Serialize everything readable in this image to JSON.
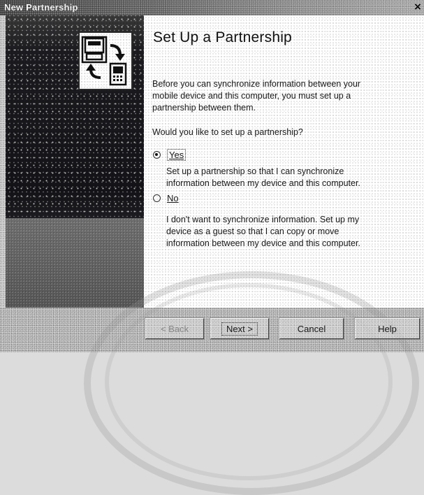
{
  "window": {
    "title": "New Partnership",
    "close_glyph": "×"
  },
  "graphic": {
    "icon": "sync-devices-icon"
  },
  "page": {
    "heading": "Set Up a Partnership",
    "intro": "Before you can synchronize information between your mobile device and this computer, you must set up a partnership between them.",
    "question": "Would you like to set up a partnership?"
  },
  "options": {
    "yes": {
      "label": "Yes",
      "checked": true,
      "description": "Set up a partnership so that I can synchronize information between my device and this computer."
    },
    "no": {
      "label": "No",
      "checked": false,
      "description": "I don't want to synchronize information. Set up my device as a guest so that I can copy or move information between my device and this computer."
    }
  },
  "buttons": {
    "back": "< Back",
    "next": "Next >",
    "cancel": "Cancel",
    "help": "Help"
  }
}
